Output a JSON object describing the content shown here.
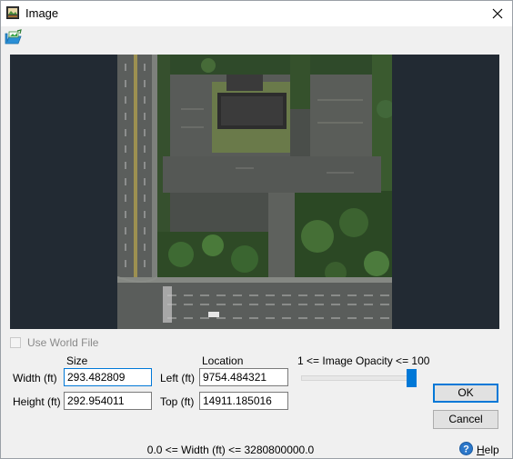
{
  "window": {
    "title": "Image"
  },
  "options": {
    "use_world_file_label": "Use World File",
    "use_world_file_checked": false
  },
  "headers": {
    "size": "Size",
    "location": "Location",
    "opacity": "1 <= Image Opacity <= 100"
  },
  "fields": {
    "width": {
      "label": "Width (ft)",
      "value": "293.482809"
    },
    "height": {
      "label": "Height (ft)",
      "value": "292.954011"
    },
    "left": {
      "label": "Left (ft)",
      "value": "9754.484321"
    },
    "top": {
      "label": "Top (ft)",
      "value": "14911.185016"
    }
  },
  "opacity": {
    "min": 1,
    "max": 100,
    "value": 100
  },
  "buttons": {
    "ok": "OK",
    "cancel": "Cancel"
  },
  "status": {
    "text": "0.0 <= Width (ft) <= 3280800000.0"
  },
  "help": {
    "label": "Help"
  },
  "icons": {
    "title": "image-app-icon",
    "toolbar": "open-image-icon",
    "close": "close-icon",
    "help": "help-icon"
  },
  "colors": {
    "accent": "#0078d7",
    "preview_bg": "#222a33"
  }
}
